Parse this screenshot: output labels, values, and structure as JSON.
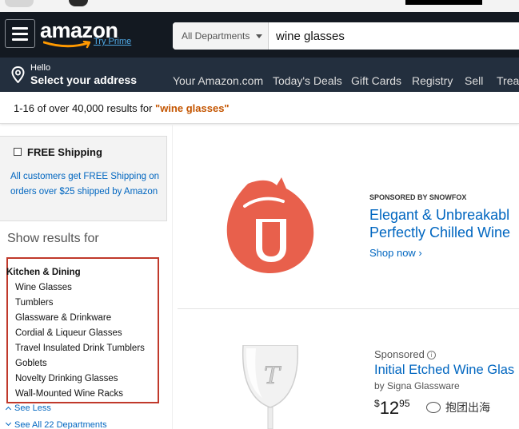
{
  "header": {
    "logo_text": "amazon",
    "prime_link": "Try Prime",
    "search": {
      "department": "All Departments",
      "query": "wine glasses"
    }
  },
  "nav": {
    "hello": "Hello",
    "address": "Select your address",
    "links": [
      "Your Amazon.com",
      "Today's Deals",
      "Gift Cards",
      "Registry",
      "Sell",
      "Treas"
    ]
  },
  "results": {
    "count_text": "1-16 of over 40,000 results for ",
    "query_quoted": "\"wine glasses\""
  },
  "sidebar": {
    "free_shipping_label": "FREE Shipping",
    "free_shipping_desc": "All customers get FREE Shipping on orders over $25 shipped by Amazon",
    "show_results_for": "Show results for",
    "category_header": "Kitchen & Dining",
    "categories": [
      "Wine Glasses",
      "Tumblers",
      "Glassware & Drinkware",
      "Cordial & Liqueur Glasses",
      "Travel Insulated Drink Tumblers",
      "Goblets",
      "Novelty Drinking Glasses",
      "Wall-Mounted Wine Racks"
    ],
    "see_less": "See Less",
    "see_all": "See All 22 Departments"
  },
  "sponsored_ad": {
    "label": "SPONSORED BY SNOWFOX",
    "title_line1": "Elegant & Unbreakabl",
    "title_line2": "Perfectly Chilled Wine",
    "cta": "Shop now ›",
    "logo_color": "#e8604c"
  },
  "product": {
    "sponsored_label": "Sponsored",
    "title": "Initial Etched Wine Glas",
    "by": "by Signa Glassware",
    "price_symbol": "$",
    "price_whole": "12",
    "price_fraction": "95",
    "etched_letter": "T"
  },
  "watermark": {
    "text": "抱团出海"
  },
  "colors": {
    "header_bg": "#131921",
    "nav_bg": "#232f3e",
    "link": "#0066c0",
    "query_highlight": "#c45500",
    "annotation_box": "#c0392b"
  }
}
